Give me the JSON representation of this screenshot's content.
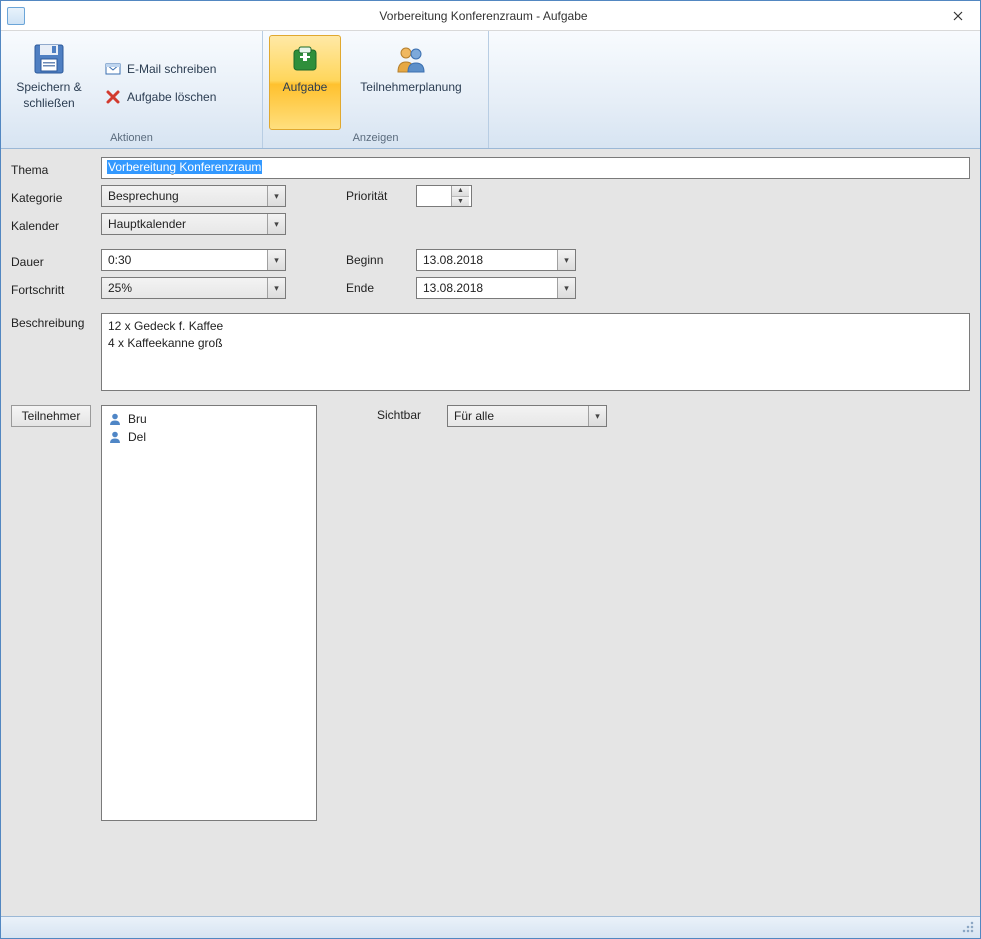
{
  "window": {
    "title": "Vorbereitung Konferenzraum - Aufgabe"
  },
  "ribbon": {
    "groups": {
      "actions": {
        "label": "Aktionen",
        "save_close": "Speichern & schließen",
        "email": "E-Mail schreiben",
        "delete": "Aufgabe löschen"
      },
      "views": {
        "label": "Anzeigen",
        "task": "Aufgabe",
        "participants": "Teilnehmerplanung"
      }
    }
  },
  "form": {
    "labels": {
      "thema": "Thema",
      "kategorie": "Kategorie",
      "prioritaet": "Priorität",
      "kalender": "Kalender",
      "dauer": "Dauer",
      "beginn": "Beginn",
      "fortschritt": "Fortschritt",
      "ende": "Ende",
      "beschreibung": "Beschreibung",
      "teilnehmer": "Teilnehmer",
      "sichtbar": "Sichtbar"
    },
    "values": {
      "thema": "Vorbereitung Konferenzraum",
      "kategorie": "Besprechung",
      "prioritaet": "",
      "kalender": "Hauptkalender",
      "dauer": "0:30",
      "beginn": "13.08.2018",
      "fortschritt": "25%",
      "ende": "13.08.2018",
      "beschreibung": "12 x Gedeck f. Kaffee\n4 x Kaffeekanne groß",
      "sichtbar": "Für alle"
    },
    "teilnehmer_list": [
      "Bru",
      "Del"
    ]
  }
}
